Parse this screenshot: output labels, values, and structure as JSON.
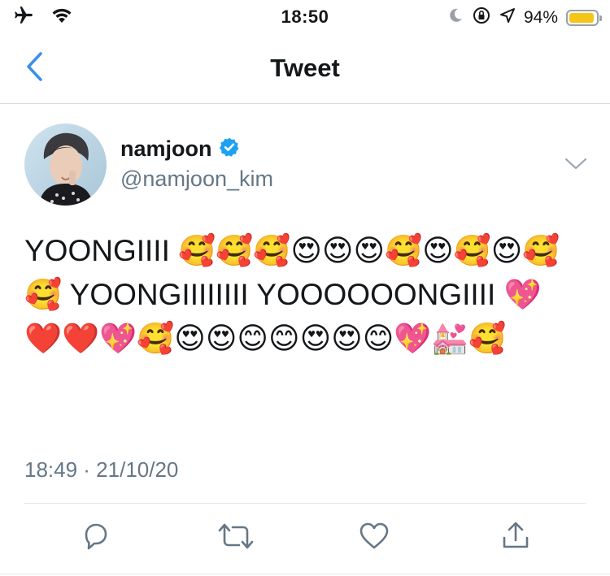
{
  "status_bar": {
    "time": "18:50",
    "battery_percent_label": "94%",
    "battery_level": 0.94,
    "icons": [
      "airplane-icon",
      "wifi-icon",
      "moon-icon",
      "rotation-lock-icon",
      "location-icon",
      "battery-icon"
    ]
  },
  "nav": {
    "title": "Tweet",
    "back_icon": "chevron-left-icon"
  },
  "tweet": {
    "author_name": "namjoon",
    "verified": true,
    "handle": "@namjoon_kim",
    "text": "YOONGIIII 🥰🥰🥰😍😍😍🥰😍🥰😍🥰🥰 YOONGIIIIIIII YOOOOOONGIIII 💖❤️❤️💖🥰😍😍😊😊😍😍😊💖💒🥰",
    "timestamp": "18:49 · 21/10/20"
  },
  "actions": [
    "reply-icon",
    "retweet-icon",
    "like-icon",
    "share-icon"
  ],
  "colors": {
    "accent": "#1da1f2",
    "text": "#14171a",
    "secondary": "#657786",
    "battery": "#f5c518",
    "back": "#3b8fe8"
  }
}
